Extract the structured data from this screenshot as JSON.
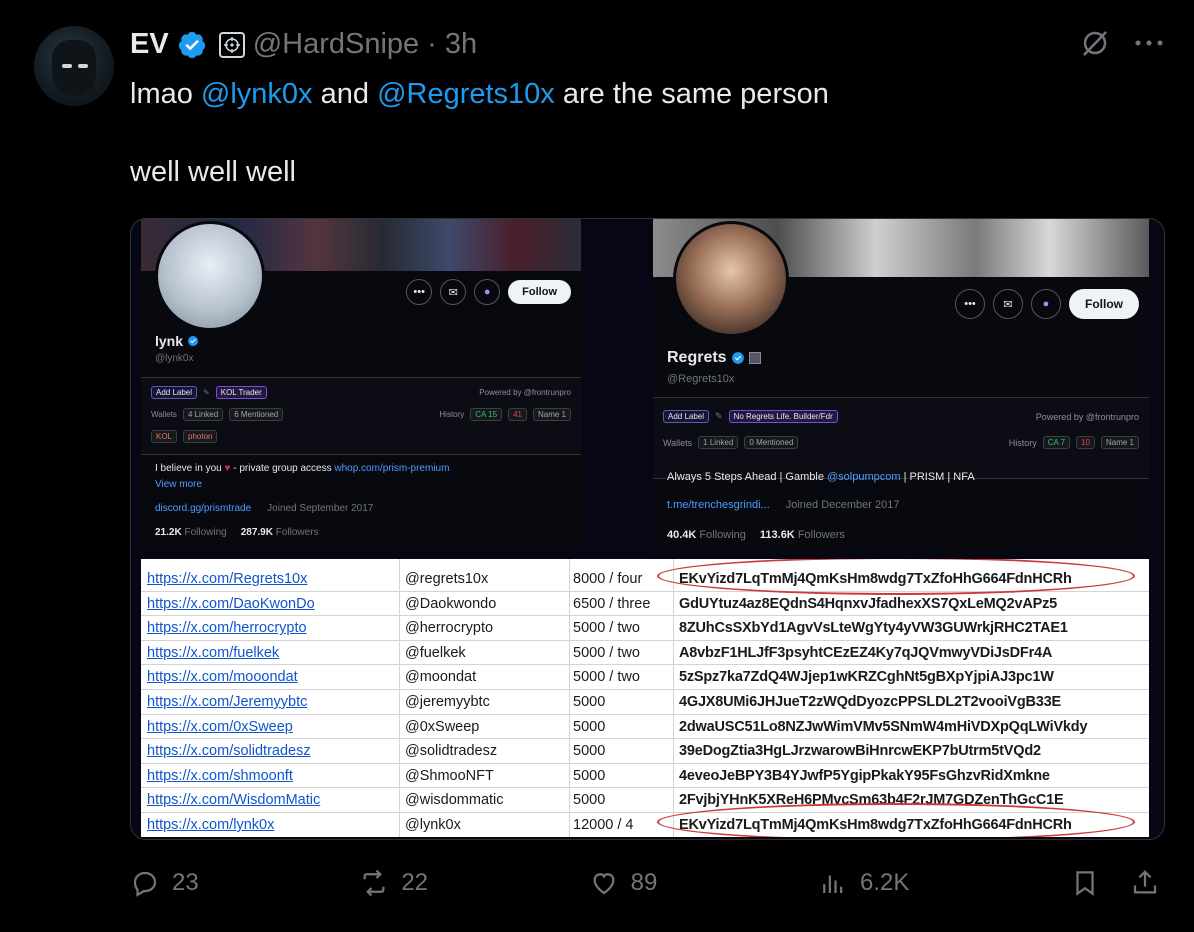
{
  "author": {
    "name": "EV",
    "handle": "@HardSnipe",
    "time": "· 3h"
  },
  "tweet": {
    "line1_pre": "lmao ",
    "mention1": "@lynk0x",
    "line1_mid": " and ",
    "mention2": "@Regrets10x",
    "line1_post": " are the same person",
    "line2": "well well well"
  },
  "profile_left": {
    "name": "lynk",
    "handle": "@lynk0x",
    "follow": "Follow",
    "add_label": "Add Label",
    "tag": "KOL Trader",
    "powered": "Powered by @frontrunpro",
    "wallets_label": "Wallets",
    "linked": "4 Linked",
    "mentioned": "6 Mentioned",
    "history_label": "History",
    "ca": "CA 15",
    "ca_red": "41",
    "name_chip": "Name 1",
    "tag2": "KOL",
    "tag3": "photon",
    "bio_pre": "I believe in you ",
    "bio_mid": " - private group access ",
    "bio_link": "whop.com/prism-premium",
    "view_more": "View more",
    "link": "discord.gg/prismtrade",
    "joined": "Joined September 2017",
    "following_n": "21.2K",
    "following_l": "Following",
    "followers_n": "287.9K",
    "followers_l": "Followers"
  },
  "profile_right": {
    "name": "Regrets",
    "handle": "@Regrets10x",
    "follow": "Follow",
    "add_label": "Add Label",
    "tag": "No Regrets Life. Builder/Fdr",
    "powered": "Powered by @frontrunpro",
    "wallets_label": "Wallets",
    "linked": "1 Linked",
    "mentioned": "0 Mentioned",
    "history_label": "History",
    "ca": "CA 7",
    "ca_red": "10",
    "name_chip": "Name 1",
    "bio_pre": "Always 5 Steps Ahead | Gamble ",
    "bio_link": "@solpumpcom",
    "bio_post": " | PRISM | NFA",
    "link": "t.me/trenchesgrindi...",
    "joined": "Joined December 2017",
    "following_n": "40.4K",
    "following_l": "Following",
    "followers_n": "113.6K",
    "followers_l": "Followers"
  },
  "sheet_rows": [
    {
      "url": "https://x.com/Regrets10x",
      "handle": "@regrets10x",
      "amount": "8000 / four",
      "address": "EKvYizd7LqTmMj4QmKsHm8wdg7TxZfoHhG664FdnHCRh"
    },
    {
      "url": "https://x.com/DaoKwonDo",
      "handle": "@Daokwondo",
      "amount": "6500 / three",
      "address": "GdUYtuz4az8EQdnS4HqnxvJfadhexXS7QxLeMQ2vAPz5"
    },
    {
      "url": "https://x.com/herrocrypto",
      "handle": "@herrocrypto",
      "amount": "5000 / two",
      "address": "8ZUhCsSXbYd1AgvVsLteWgYty4yVW3GUWrkjRHC2TAE1"
    },
    {
      "url": "https://x.com/fuelkek",
      "handle": "@fuelkek",
      "amount": "5000 / two",
      "address": "A8vbzF1HLJfF3psyhtCEzEZ4Ky7qJQVmwyVDiJsDFr4A"
    },
    {
      "url": "https://x.com/mooondat",
      "handle": "@moondat",
      "amount": "5000 / two",
      "address": "5zSpz7ka7ZdQ4WJjep1wKRZCghNt5gBXpYjpiAJ3pc1W"
    },
    {
      "url": "https://x.com/Jeremyybtc",
      "handle": "@jeremyybtc",
      "amount": "5000",
      "address": "4GJX8UMi6JHJueT2zWQdDyozcPPSLDL2T2vooiVgB33E"
    },
    {
      "url": "https://x.com/0xSweep",
      "handle": "@0xSweep",
      "amount": "5000",
      "address": "2dwaUSC51Lo8NZJwWimVMv5SNmW4mHiVDXpQqLWiVkdy"
    },
    {
      "url": "https://x.com/solidtradesz",
      "handle": "@solidtradesz",
      "amount": "5000",
      "address": "39eDogZtia3HgLJrzwarowBiHnrcwEKP7bUtrm5tVQd2"
    },
    {
      "url": "https://x.com/shmoonft",
      "handle": "@ShmooNFT",
      "amount": "5000",
      "address": "4eveoJeBPY3B4YJwfP5YgipPkakY95FsGhzvRidXmkne"
    },
    {
      "url": "https://x.com/WisdomMatic",
      "handle": "@wisdommatic",
      "amount": "5000",
      "address": "2FvjbjYHnK5XReH6PMvcSm63b4F2rJM7GDZenThGcC1E"
    },
    {
      "url": "https://x.com/lynk0x",
      "handle": "@lynk0x",
      "amount": "12000 / 4",
      "address": "EKvYizd7LqTmMj4QmKsHm8wdg7TxZfoHhG664FdnHCRh"
    }
  ],
  "actions": {
    "replies": "23",
    "reposts": "22",
    "likes": "89",
    "views": "6.2K"
  },
  "colors": {
    "background": "#000000",
    "accent": "#1d9bf0",
    "muted": "#71767b",
    "oval": "#cc3b3b"
  }
}
